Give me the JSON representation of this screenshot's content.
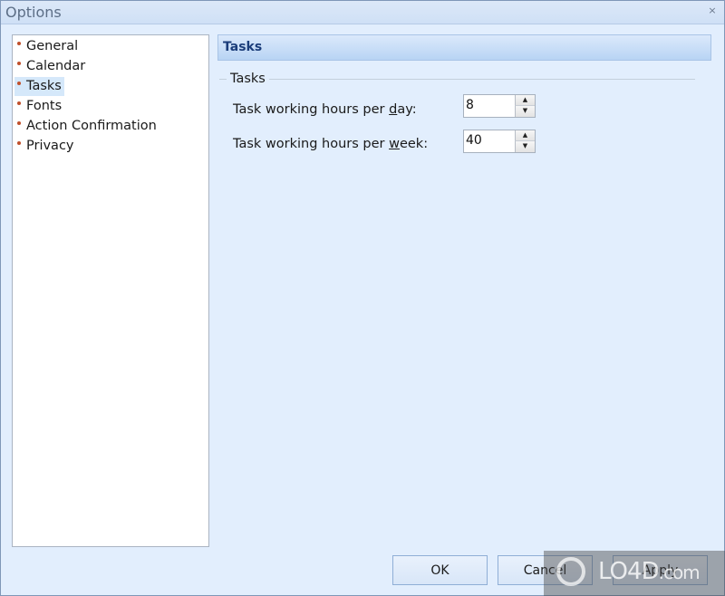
{
  "window": {
    "title": "Options",
    "close_glyph": "×"
  },
  "nav": {
    "items": [
      {
        "label": "General",
        "selected": false
      },
      {
        "label": "Calendar",
        "selected": false
      },
      {
        "label": "Tasks",
        "selected": true
      },
      {
        "label": "Fonts",
        "selected": false
      },
      {
        "label": "Action Confirmation",
        "selected": false
      },
      {
        "label": "Privacy",
        "selected": false
      }
    ]
  },
  "panel": {
    "header": "Tasks",
    "group_label": "Tasks",
    "fields": [
      {
        "label_pre": "Task working hours per ",
        "label_accel": "d",
        "label_post": "ay:",
        "value": "8"
      },
      {
        "label_pre": "Task working hours per ",
        "label_accel": "w",
        "label_post": "eek:",
        "value": "40"
      }
    ],
    "spin_up_glyph": "▲",
    "spin_down_glyph": "▼"
  },
  "buttons": {
    "ok": "OK",
    "cancel": "Cancel",
    "apply": "Apply"
  },
  "watermark": {
    "text": "LO4D",
    "suffix": ".com"
  }
}
